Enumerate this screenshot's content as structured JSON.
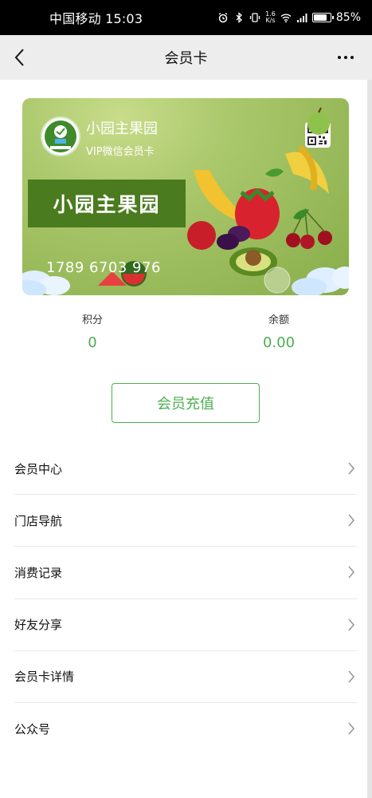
{
  "status_bar": {
    "carrier_time": "中国移动 15:03",
    "net_speed_value": "1.6",
    "net_speed_unit": "K/s",
    "battery_percent": "85%",
    "battery_level": 0.85,
    "icons": [
      "alarm-icon",
      "bluetooth-icon",
      "vibrate-icon",
      "wifi-icon",
      "signal-icon",
      "battery-icon"
    ]
  },
  "nav": {
    "title": "会员卡",
    "back_icon": "chevron-left-icon",
    "more_icon": "more-dots-icon"
  },
  "card": {
    "shop_name": "小园主果园",
    "card_type": "VIP微信会员卡",
    "banner_text": "小园主果园",
    "card_number": "1789 6703 976",
    "logo_text": "小园主果园",
    "qr_icon": "qr-code-icon",
    "colors": {
      "card_bg": "#9ebd5e",
      "banner_bg": "#4a7b1e"
    }
  },
  "stats": {
    "points_label": "积分",
    "points_value": "0",
    "balance_label": "余额",
    "balance_value": "0.00"
  },
  "recharge_button": "会员充值",
  "menu": [
    {
      "label": "会员中心"
    },
    {
      "label": "门店导航"
    },
    {
      "label": "消费记录"
    },
    {
      "label": "好友分享"
    },
    {
      "label": "会员卡详情"
    },
    {
      "label": "公众号"
    }
  ],
  "colors": {
    "accent": "#4caf50",
    "nav_bg": "#ededed"
  }
}
